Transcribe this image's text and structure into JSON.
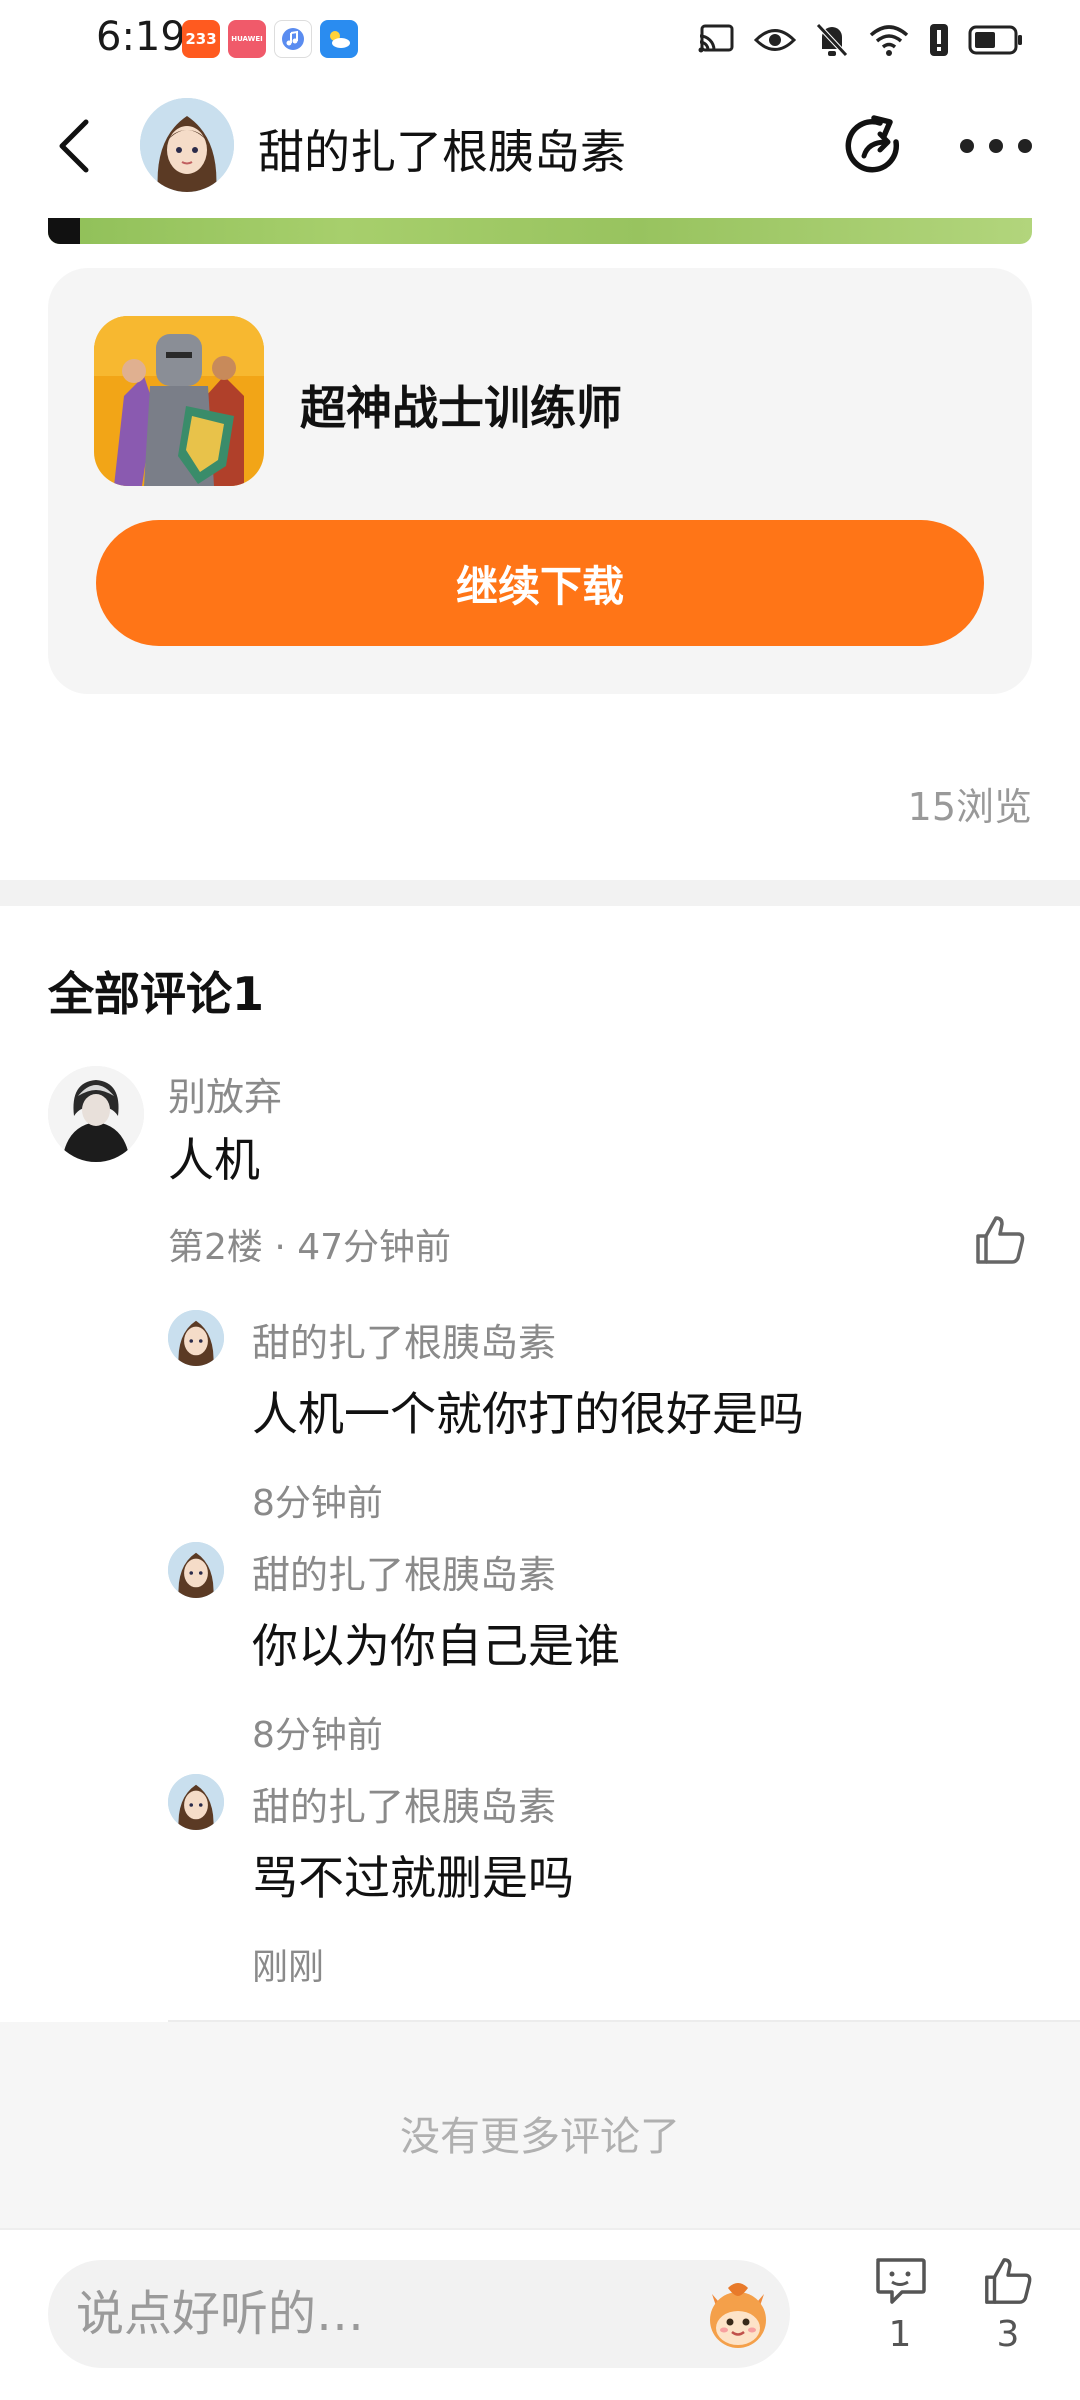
{
  "status_bar": {
    "time": "6:19",
    "app_icons": [
      {
        "name": "233-app-icon",
        "label": "233",
        "color": "#ff5a1f"
      },
      {
        "name": "huawei-app-icon",
        "label": "HUAWEI",
        "color": "#f05a6a"
      },
      {
        "name": "music-app-icon",
        "label": "",
        "color": "#5a8cf0"
      },
      {
        "name": "weather-app-icon",
        "label": "",
        "color": "#2a8cf0"
      }
    ]
  },
  "header": {
    "title": "甜的扎了根胰岛素"
  },
  "game_card": {
    "name": "超神战士训练师",
    "download_label": "继续下载",
    "accent": "#ff7517"
  },
  "views": "15浏览",
  "comments": {
    "title": "全部评论1",
    "main": {
      "user": "别放弃",
      "text": "人机",
      "meta": "第2楼 · 47分钟前"
    },
    "replies": [
      {
        "user": "甜的扎了根胰岛素",
        "text": "人机一个就你打的很好是吗",
        "time": "8分钟前"
      },
      {
        "user": "甜的扎了根胰岛素",
        "text": "你以为你自己是谁",
        "time": "8分钟前"
      },
      {
        "user": "甜的扎了根胰岛素",
        "text": "骂不过就删是吗",
        "time": "刚刚"
      }
    ],
    "no_more": "没有更多评论了"
  },
  "bottom_bar": {
    "input_placeholder": "说点好听的…",
    "comment_count": "1",
    "like_count": "3"
  }
}
